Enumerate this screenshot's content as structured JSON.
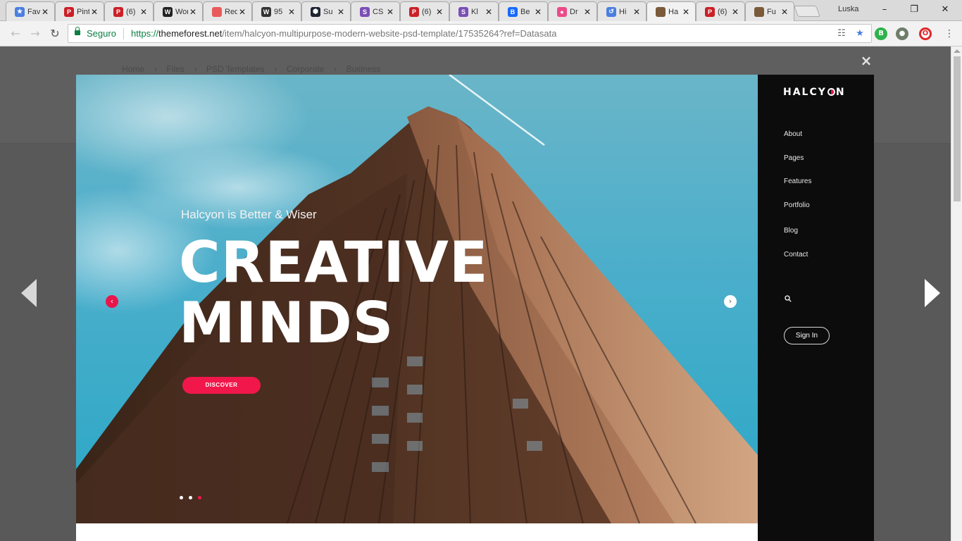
{
  "browser": {
    "tabs": [
      {
        "title": "Favoritos",
        "favicon": "star-icon",
        "color": "#4a7fe0"
      },
      {
        "title": "Pinterest",
        "favicon": "pinterest-icon",
        "color": "#cb1f27"
      },
      {
        "title": "(6)",
        "favicon": "pinterest-icon",
        "color": "#cb1f27"
      },
      {
        "title": "WordPress",
        "favicon": "wordpress-icon",
        "color": "#222222"
      },
      {
        "title": "Red",
        "favicon": "red-square-icon",
        "color": "#e85b5b"
      },
      {
        "title": "95",
        "favicon": "w-icon",
        "color": "#333333"
      },
      {
        "title": "Su",
        "favicon": "hexagon-icon",
        "color": "#1e2430"
      },
      {
        "title": "CS",
        "favicon": "s-icon",
        "color": "#7a4fb5"
      },
      {
        "title": "(6)",
        "favicon": "pinterest-icon",
        "color": "#cb1f27"
      },
      {
        "title": "Kl",
        "favicon": "s-icon",
        "color": "#7a4fb5"
      },
      {
        "title": "Be",
        "favicon": "behance-icon",
        "color": "#1769ff"
      },
      {
        "title": "Dr",
        "favicon": "dribbble-icon",
        "color": "#ea4c89"
      },
      {
        "title": "Hi",
        "favicon": "history-icon",
        "color": "#4a7fe0"
      },
      {
        "title": "Ha",
        "favicon": "themeforest-icon",
        "color": "#7a5a3a",
        "active": true
      },
      {
        "title": "(6)",
        "favicon": "pinterest-icon",
        "color": "#cb1f27"
      },
      {
        "title": "Fu",
        "favicon": "themeforest-icon",
        "color": "#7a5a3a"
      }
    ],
    "user": "Luska",
    "secure_label": "Seguro",
    "url_scheme": "https://",
    "url_host": "themeforest.net",
    "url_path": "/item/halcyon-multipurpose-modern-website-psd-template/17535264?ref=Datasata"
  },
  "breadcrumb": [
    "Home",
    "Files",
    "PSD Templates",
    "Corporate",
    "Business"
  ],
  "lightbox": {
    "close_label": "×"
  },
  "preview": {
    "hero_subtitle": "Halcyon is Better & Wiser",
    "hero_title_line1": "CREATIVE",
    "hero_title_line2": "MINDS",
    "cta_label": "DISCOVER",
    "slide_count": 3,
    "active_slide": 3,
    "accent_color": "#f2174b"
  },
  "sidebar": {
    "logo": "HALCYON",
    "menu": [
      "About",
      "Pages",
      "Features",
      "Portfolio",
      "Blog",
      "Contact"
    ],
    "signin_label": "Sign In"
  }
}
